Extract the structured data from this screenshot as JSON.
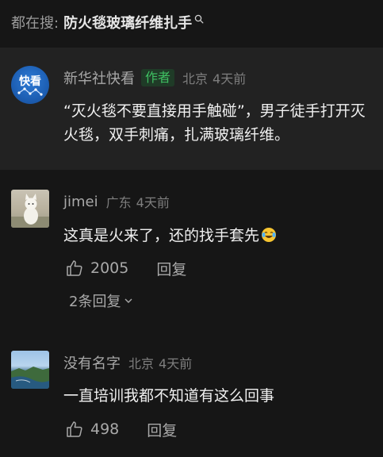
{
  "search": {
    "prefix": "都在搜:",
    "query": "防火毯玻璃纤维扎手"
  },
  "author_post": {
    "avatar_text": "快看",
    "user_name": "新华社快看",
    "badge": "作者",
    "location": "北京",
    "time": "4天前",
    "text": "“灭火毯不要直接用手触碰”，男子徒手打开灭火毯，双手刺痛，扎满玻璃纤维。"
  },
  "comments": [
    {
      "user_name": "jimei",
      "location": "广东",
      "time": "4天前",
      "text": "这真是火来了，还的找手套先",
      "emoji": "crying-laughing-emoji",
      "like_count": "2005",
      "reply_label": "回复",
      "expand_label": "2条回复"
    },
    {
      "user_name": "没有名字",
      "location": "北京",
      "time": "4天前",
      "text": "一直培训我都不知道有这么回事",
      "like_count": "498",
      "reply_label": "回复"
    }
  ],
  "colors": {
    "background": "#161616",
    "author_background": "#222222",
    "author_badge": "#3fbf62"
  }
}
